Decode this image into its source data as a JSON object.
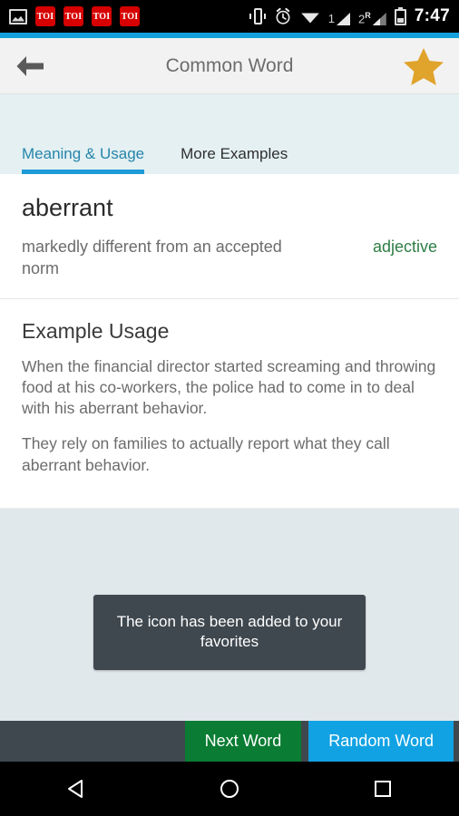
{
  "statusbar": {
    "icons": [
      {
        "name": "gallery-image-icon",
        "label": "image"
      },
      {
        "name": "toi-notification-icon",
        "label": "TOI"
      },
      {
        "name": "toi-notification-icon",
        "label": "TOI"
      },
      {
        "name": "toi-notification-icon",
        "label": "TOI"
      },
      {
        "name": "toi-notification-icon",
        "label": "TOI"
      }
    ],
    "vibrate": "vibrate-icon",
    "alarm": "alarm-icon",
    "wifi": "wifi-icon",
    "sim1_label": "1",
    "sim2_label": "2",
    "sim2_roaming": "R",
    "battery": "battery-icon",
    "time": "7:47"
  },
  "appbar": {
    "back": "back-arrow-icon",
    "title": "Common Word",
    "favorite": "star-icon",
    "star_color": "#e0a32b"
  },
  "tabs": [
    {
      "label": "Meaning & Usage",
      "active": true
    },
    {
      "label": "More Examples",
      "active": false
    }
  ],
  "word": {
    "term": "aberrant",
    "definition": "markedly different from an accepted norm",
    "part_of_speech": "adjective",
    "pos_color": "#2e7d45"
  },
  "example": {
    "heading": "Example Usage",
    "sentences": [
      "When the financial director started screaming and throwing food at his co-workers, the police had to come in to deal with his aberrant behavior.",
      "They rely on families to actually report what they call aberrant behavior."
    ]
  },
  "toast": {
    "message": "The icon has been added to your favorites"
  },
  "buttons": {
    "next": "Next Word",
    "next_color": "#0a7c33",
    "random": "Random Word",
    "random_color": "#11a2e3"
  },
  "navbar": {
    "back": "nav-back-icon",
    "home": "nav-home-icon",
    "recents": "nav-recents-icon"
  }
}
